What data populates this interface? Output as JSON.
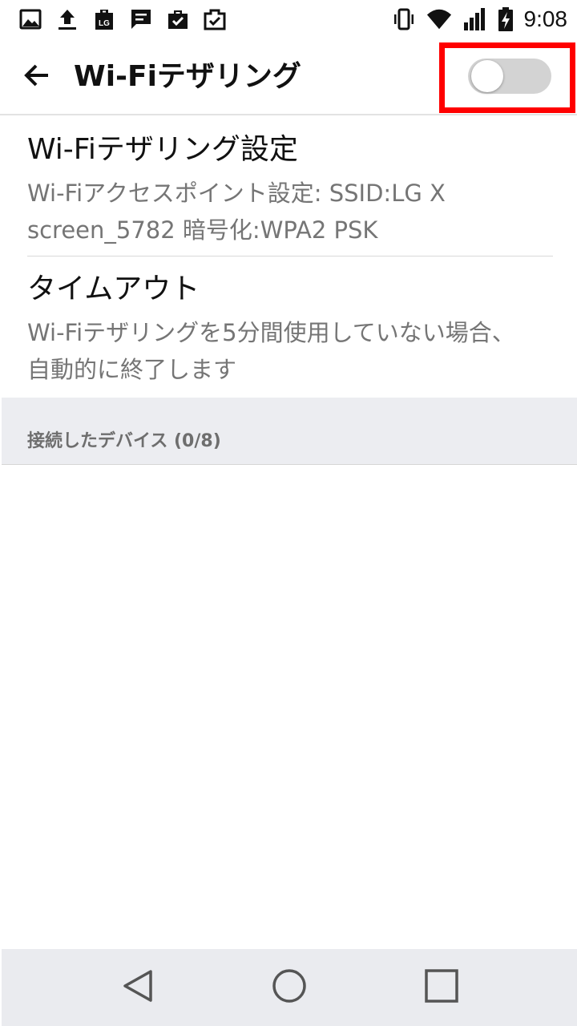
{
  "status_bar": {
    "time": "9:08",
    "left_icons": [
      "image-icon",
      "upload-icon",
      "lg-icon",
      "message-icon",
      "briefcase-check-icon",
      "clipboard-check-icon"
    ],
    "right_icons": [
      "vibrate-icon",
      "wifi-icon",
      "signal-icon",
      "battery-charging-icon"
    ],
    "lg_badge": "LG"
  },
  "app_bar": {
    "title": "Wi-Fiテザリング",
    "back_icon": "arrow-left-icon",
    "toggle_on": false,
    "highlight_color": "#ff0000"
  },
  "settings": {
    "wifi_settings": {
      "title": "Wi-Fiテザリング設定",
      "summary": "Wi-Fiアクセスポイント設定: SSID:LG X screen_5782 暗号化:WPA2 PSK"
    },
    "timeout": {
      "title": "タイムアウト",
      "summary": "Wi-Fiテザリングを5分間使用していない場合、自動的に終了します"
    }
  },
  "connected_devices": {
    "header": "接続したデバイス (0/8)"
  },
  "nav_bar": {
    "icons": [
      "nav-back-icon",
      "nav-home-icon",
      "nav-recents-icon"
    ]
  }
}
